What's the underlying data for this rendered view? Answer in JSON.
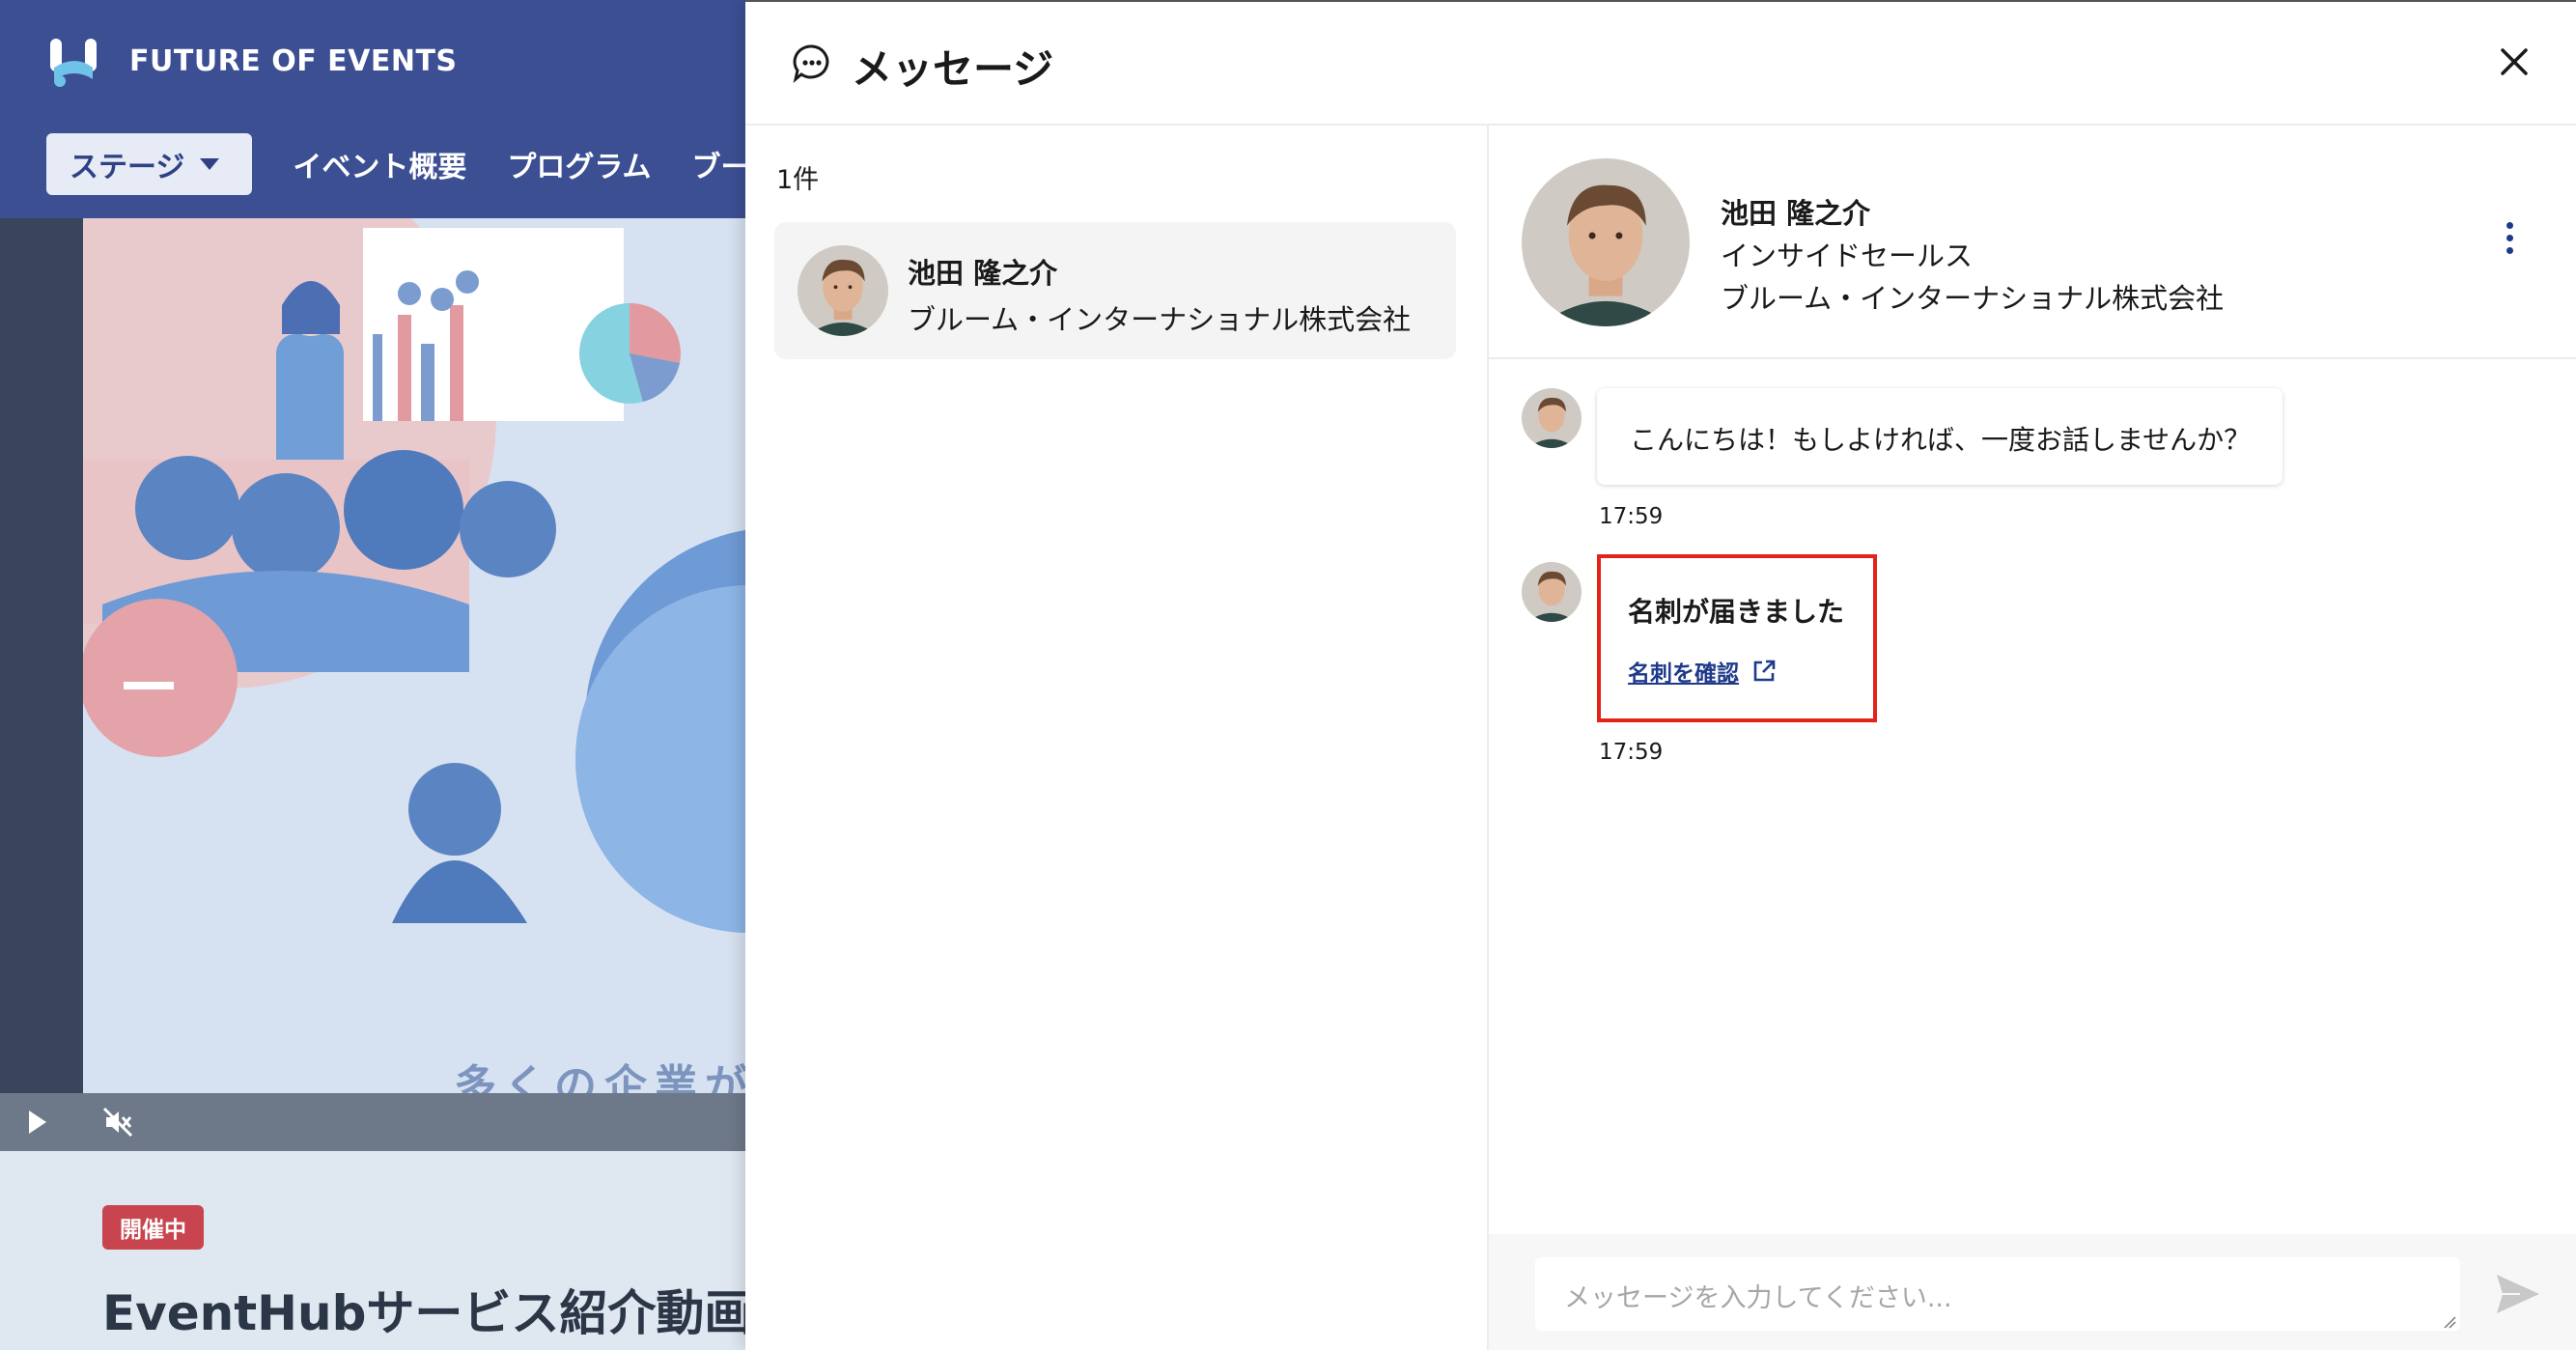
{
  "background_app": {
    "brand_name": "FUTURE OF EVENTS",
    "nav": {
      "stage_label": "ステージ",
      "items": [
        "イベント概要",
        "プログラム",
        "ブー"
      ]
    },
    "video": {
      "caption": "多くの企業が"
    },
    "event": {
      "status_badge": "開催中",
      "title": "EventHubサービス紹介動画"
    }
  },
  "panel": {
    "title": "メッセージ"
  },
  "conversation_list": {
    "count_label": "1件",
    "items": [
      {
        "name": "池田 隆之介",
        "company": "ブルーム・インターナショナル株式会社"
      }
    ]
  },
  "chat": {
    "profile": {
      "name": "池田 隆之介",
      "role": "インサイドセールス",
      "company": "ブルーム・インターナショナル株式会社"
    },
    "messages": [
      {
        "text": "こんにちは！もしよければ、一度お話しませんか？",
        "time": "17:59"
      },
      {
        "title": "名刺が届きました",
        "link_label": "名刺を確認",
        "time": "17:59"
      }
    ],
    "composer": {
      "placeholder": "メッセージを入力してください..."
    }
  },
  "colors": {
    "header_blue": "#3c4f93",
    "link_navy": "#1f3a8a",
    "highlight_red": "#e2231a",
    "live_badge_red": "#c8454f"
  },
  "icons": [
    "brand-logo",
    "caret-down-icon",
    "play-icon",
    "mute-icon",
    "chat-bubble-icon",
    "close-icon",
    "more-vertical-icon",
    "external-link-icon",
    "send-icon"
  ]
}
